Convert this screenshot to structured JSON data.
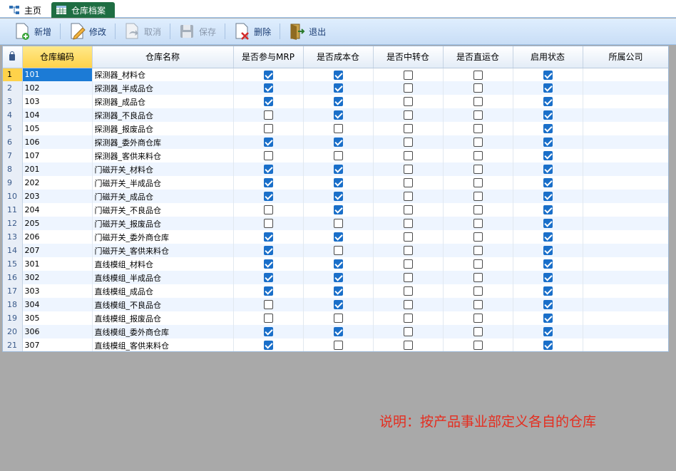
{
  "tabs": [
    {
      "label": "主页",
      "icon": "sitemap-icon",
      "active": false
    },
    {
      "label": "仓库档案",
      "icon": "table-icon",
      "active": true
    }
  ],
  "toolbar": {
    "add": "新增",
    "edit": "修改",
    "cancel": "取消",
    "save": "保存",
    "delete": "删除",
    "exit": "退出"
  },
  "grid": {
    "columns": [
      "仓库编码",
      "仓库名称",
      "是否参与MRP",
      "是否成本仓",
      "是否中转仓",
      "是否直运仓",
      "启用状态",
      "所属公司"
    ],
    "rows": [
      {
        "num": "1",
        "code": "101",
        "name": "探测器_材料仓",
        "mrp": true,
        "cost": true,
        "transit": false,
        "direct": false,
        "enabled": true,
        "company": ""
      },
      {
        "num": "2",
        "code": "102",
        "name": "探测器_半成品仓",
        "mrp": true,
        "cost": true,
        "transit": false,
        "direct": false,
        "enabled": true,
        "company": ""
      },
      {
        "num": "3",
        "code": "103",
        "name": "探测器_成品仓",
        "mrp": true,
        "cost": true,
        "transit": false,
        "direct": false,
        "enabled": true,
        "company": ""
      },
      {
        "num": "4",
        "code": "104",
        "name": "探测器_不良品仓",
        "mrp": false,
        "cost": true,
        "transit": false,
        "direct": false,
        "enabled": true,
        "company": ""
      },
      {
        "num": "5",
        "code": "105",
        "name": "探测器_报废品仓",
        "mrp": false,
        "cost": false,
        "transit": false,
        "direct": false,
        "enabled": true,
        "company": ""
      },
      {
        "num": "6",
        "code": "106",
        "name": "探测器_委外商仓库",
        "mrp": true,
        "cost": true,
        "transit": false,
        "direct": false,
        "enabled": true,
        "company": ""
      },
      {
        "num": "7",
        "code": "107",
        "name": "探测器_客供来料仓",
        "mrp": false,
        "cost": false,
        "transit": false,
        "direct": false,
        "enabled": true,
        "company": ""
      },
      {
        "num": "8",
        "code": "201",
        "name": "门磁开关_材料仓",
        "mrp": true,
        "cost": true,
        "transit": false,
        "direct": false,
        "enabled": true,
        "company": ""
      },
      {
        "num": "9",
        "code": "202",
        "name": "门磁开关_半成品仓",
        "mrp": true,
        "cost": true,
        "transit": false,
        "direct": false,
        "enabled": true,
        "company": ""
      },
      {
        "num": "10",
        "code": "203",
        "name": "门磁开关_成品仓",
        "mrp": true,
        "cost": true,
        "transit": false,
        "direct": false,
        "enabled": true,
        "company": ""
      },
      {
        "num": "11",
        "code": "204",
        "name": "门磁开关_不良品仓",
        "mrp": false,
        "cost": true,
        "transit": false,
        "direct": false,
        "enabled": true,
        "company": ""
      },
      {
        "num": "12",
        "code": "205",
        "name": "门磁开关_报废品仓",
        "mrp": false,
        "cost": false,
        "transit": false,
        "direct": false,
        "enabled": true,
        "company": ""
      },
      {
        "num": "13",
        "code": "206",
        "name": "门磁开关_委外商仓库",
        "mrp": true,
        "cost": true,
        "transit": false,
        "direct": false,
        "enabled": true,
        "company": ""
      },
      {
        "num": "14",
        "code": "207",
        "name": "门磁开关_客供来料仓",
        "mrp": true,
        "cost": false,
        "transit": false,
        "direct": false,
        "enabled": true,
        "company": ""
      },
      {
        "num": "15",
        "code": "301",
        "name": "直线模组_材料仓",
        "mrp": true,
        "cost": true,
        "transit": false,
        "direct": false,
        "enabled": true,
        "company": ""
      },
      {
        "num": "16",
        "code": "302",
        "name": "直线模组_半成品仓",
        "mrp": true,
        "cost": true,
        "transit": false,
        "direct": false,
        "enabled": true,
        "company": ""
      },
      {
        "num": "17",
        "code": "303",
        "name": "直线模组_成品仓",
        "mrp": true,
        "cost": true,
        "transit": false,
        "direct": false,
        "enabled": true,
        "company": ""
      },
      {
        "num": "18",
        "code": "304",
        "name": "直线模组_不良品仓",
        "mrp": false,
        "cost": true,
        "transit": false,
        "direct": false,
        "enabled": true,
        "company": ""
      },
      {
        "num": "19",
        "code": "305",
        "name": "直线模组_报废品仓",
        "mrp": false,
        "cost": false,
        "transit": false,
        "direct": false,
        "enabled": true,
        "company": ""
      },
      {
        "num": "20",
        "code": "306",
        "name": "直线模组_委外商仓库",
        "mrp": true,
        "cost": true,
        "transit": false,
        "direct": false,
        "enabled": true,
        "company": ""
      },
      {
        "num": "21",
        "code": "307",
        "name": "直线模组_客供来料仓",
        "mrp": true,
        "cost": false,
        "transit": false,
        "direct": false,
        "enabled": true,
        "company": ""
      }
    ]
  },
  "note": "说明：按产品事业部定义各自的仓库",
  "colors": {
    "accent": "#1f6e43",
    "checkbox": "#1a6fc9",
    "note": "#e52d1f",
    "selection": "#1c7bd6",
    "sorted_header": "#ffd24a"
  }
}
